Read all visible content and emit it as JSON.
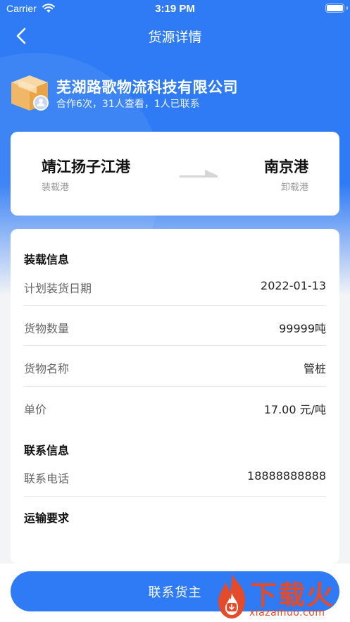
{
  "status_bar": {
    "carrier": "Carrier",
    "time": "3:19 PM"
  },
  "nav": {
    "title": "货源详情"
  },
  "company": {
    "name": "芜湖路歌物流科技有限公司",
    "stats": "合作6次，31人查看，1人已联系"
  },
  "route": {
    "from": {
      "name": "靖江扬子江港",
      "label": "装载港"
    },
    "to": {
      "name": "南京港",
      "label": "卸载港"
    }
  },
  "loading_section": {
    "title": "装载信息",
    "rows": [
      {
        "label": "计划装货日期",
        "value": "2022-01-13"
      },
      {
        "label": "货物数量",
        "value": "99999吨"
      },
      {
        "label": "货物名称",
        "value": "管桩"
      },
      {
        "label": "单价",
        "value": "17.00 元/吨"
      }
    ]
  },
  "contact_section": {
    "title": "联系信息",
    "rows": [
      {
        "label": "联系电话",
        "value": "18888888888"
      }
    ]
  },
  "transport_section": {
    "title": "运输要求"
  },
  "action": {
    "contact_label": "联系货主"
  },
  "watermark": {
    "text": "下载火",
    "domain": "xiazaihuo.com"
  },
  "colors": {
    "primary": "#2f7bf5",
    "watermark": "#e34b2a"
  },
  "icons": [
    "wifi-icon",
    "battery-icon",
    "back-arrow-icon",
    "cargo-box-icon",
    "route-arrow-icon",
    "fire-logo-icon"
  ]
}
